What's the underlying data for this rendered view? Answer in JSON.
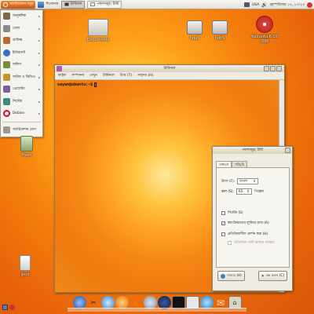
{
  "top_panel": {
    "menu_label": "অ্যাপ্লিকেশন সমূহ",
    "quick_label": "শিৰোনাম",
    "tasks": [
      "টার্মিনাল",
      "পছন্দসমূহ: টার্মি"
    ],
    "tray": {
      "keyboard": "USA",
      "clock": "বৃহস্পতিবার ১৭, ১৩:২৩"
    }
  },
  "app_menu": {
    "items": [
      {
        "label": "আনুষঙ্গিক",
        "color": "#7a6a4a"
      },
      {
        "label": "খেলা",
        "color": "#8a8a8a"
      },
      {
        "label": "গ্রাফিক্স",
        "color": "#b86a30"
      },
      {
        "label": "ইন্টারনেট",
        "color": "#3d6fbf"
      },
      {
        "label": "অফিস",
        "color": "#6f8f3a"
      },
      {
        "label": "সাউন্ড ও ভিডিও",
        "color": "#c79428"
      },
      {
        "label": "প্রোগ্রামিং",
        "color": "#7a5fa0"
      },
      {
        "label": "সিস্টেম",
        "color": "#3a8f7a"
      },
      {
        "label": "Debian",
        "color": "#c8102e"
      },
      {
        "label": "অ্যাপ্লিকেশন যোগ",
        "color": "#999999"
      }
    ]
  },
  "desktop_icons": {
    "documents": "Documents",
    "hda5": "hda5",
    "hdb5": "hdb5",
    "kubuntu": "Kubuntu 6.10 i386",
    "trash": "Trash",
    "ipod": "ipod"
  },
  "terminal": {
    "title": "টার্মিনাল",
    "menus": [
      "ফাইল",
      "সম্পাদনা",
      "দেখুন",
      "টার্মিনাল",
      "ট্যাব (T)",
      "সাহায্য (H)"
    ],
    "prompt": "sayan@ubuntu:~$"
  },
  "prefs_dialog": {
    "title": "পছন্দসমূহ: টার্মি",
    "tabs": [
      "সাধারণ",
      "পটভূমি"
    ],
    "font_label": "উৎস (F):",
    "font_value": "বাংলা",
    "scroll_label": "স্ক্রল (S):",
    "scroll_value": "65",
    "scroll_unit": "পিক্সেল",
    "opt1": {
      "label": "সিস্টেম (S)",
      "checked": false
    },
    "opt2": {
      "label": "স্বয়ংক্রিয়ভাবে লুকিয়ে রাখা (A)",
      "checked": true
    },
    "opt3": {
      "label": "প্রতিক্রিয়াশীল প্রদর্শন করা (H)",
      "checked": false
    },
    "opt4": {
      "label": "অতিরিক্ত ছোট আকার ব্যবহার",
      "checked": false
    },
    "help_button": "সাহায্য (H)",
    "close_button": "বন্ধ করুন (C)"
  }
}
